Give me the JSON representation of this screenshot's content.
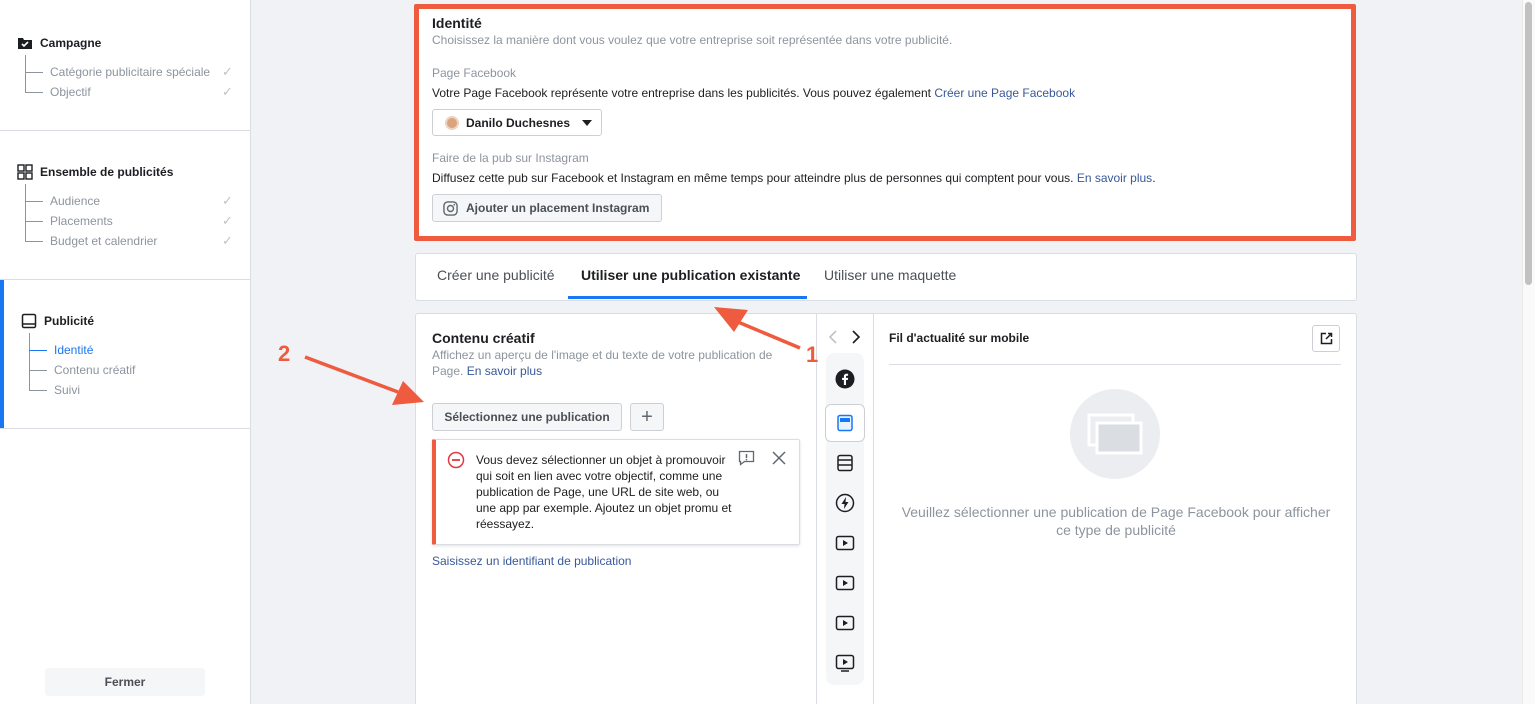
{
  "sidebar": {
    "campaign": {
      "title": "Campagne",
      "items": [
        "Catégorie publicitaire spéciale",
        "Objectif"
      ]
    },
    "adset": {
      "title": "Ensemble de publicités",
      "items": [
        "Audience",
        "Placements",
        "Budget et calendrier"
      ]
    },
    "ad": {
      "title": "Publicité",
      "items": [
        "Identité",
        "Contenu créatif",
        "Suivi"
      ]
    },
    "close_label": "Fermer"
  },
  "identity": {
    "title": "Identité",
    "subtitle": "Choisissez la manière dont vous voulez que votre entreprise soit représentée dans votre publicité.",
    "fb_page_label": "Page Facebook",
    "fb_page_text": "Votre Page Facebook représente votre entreprise dans les publicités. Vous pouvez également",
    "fb_page_link": "Créer une Page Facebook",
    "page_selector": "Danilo Duchesnes",
    "instagram_label": "Faire de la pub sur Instagram",
    "instagram_text": "Diffusez cette pub sur Facebook et Instagram en même temps pour atteindre plus de personnes qui comptent pour vous.",
    "instagram_link": "En savoir plus",
    "instagram_period": ".",
    "instagram_button": "Ajouter un placement Instagram"
  },
  "tabs": [
    "Créer une publicité",
    "Utiliser une publication existante",
    "Utiliser une maquette"
  ],
  "creative": {
    "title": "Contenu créatif",
    "desc": "Affichez un aperçu de l'image et du texte de votre publication de",
    "desc2": "Page.",
    "desc_link": "En savoir plus",
    "select_button": "Sélectionnez une publication",
    "error": "Vous devez sélectionner un objet à promouvoir qui soit en lien avec votre objectif, comme une publication de Page, une URL de site web, ou une app par exemple. Ajoutez un objet promu et réessayez.",
    "post_id_link": "Saisissez un identifiant de publication"
  },
  "preview": {
    "title": "Fil d'actualité sur mobile",
    "message": "Veuillez sélectionner une publication de Page Facebook pour afficher ce type de publicité"
  },
  "annotations": [
    "1",
    "2"
  ],
  "colors": {
    "accent": "#1877f2",
    "highlight": "#ee5b3f",
    "link": "#385898"
  }
}
